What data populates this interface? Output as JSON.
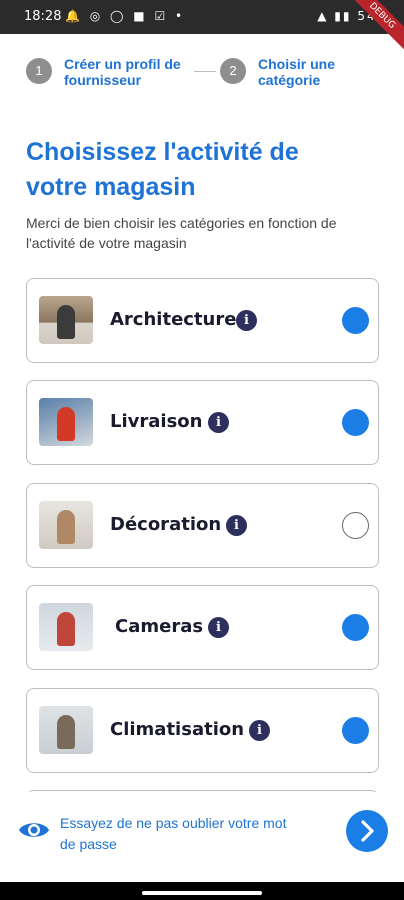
{
  "status_bar": {
    "time": "18:28",
    "notifications": "🔔 ◎ ◯ ■ ☑ •",
    "right_indicators": "▲ ▮▮ 54%",
    "debug_label": "DEBUG"
  },
  "stepper": {
    "steps": [
      {
        "number": "1",
        "line1": "Créer un profil de",
        "line2": "fournisseur"
      },
      {
        "number": "2",
        "line1": "Choisir une",
        "line2": "catégorie"
      }
    ]
  },
  "header": {
    "title_line1": "Choisissez l'activité de",
    "title_line2": "votre magasin",
    "subtitle_line1": "Merci de bien choisir les catégories en fonction de",
    "subtitle_line2": "l'activité de votre magasin"
  },
  "categories": [
    {
      "label": "Architecture",
      "selected": true,
      "image_icon": "architect-photo-icon"
    },
    {
      "label": "Livraison",
      "selected": true,
      "image_icon": "delivery-photo-icon"
    },
    {
      "label": "Décoration",
      "selected": false,
      "image_icon": "decoration-photo-icon"
    },
    {
      "label": "Cameras",
      "selected": true,
      "image_icon": "camera-install-photo-icon"
    },
    {
      "label": "Climatisation",
      "selected": true,
      "image_icon": "air-conditioning-photo-icon"
    }
  ],
  "info_glyph": "i",
  "footer": {
    "hint_line1": "Essayez de ne pas oublier votre mot",
    "hint_line2": "de passe",
    "eye_icon": "eye-icon",
    "next_icon": "chevron-right-icon"
  },
  "colors": {
    "accent": "#1f73d6",
    "radio_selected": "#1a7ee6",
    "info_icon": "#2d2f5c"
  }
}
